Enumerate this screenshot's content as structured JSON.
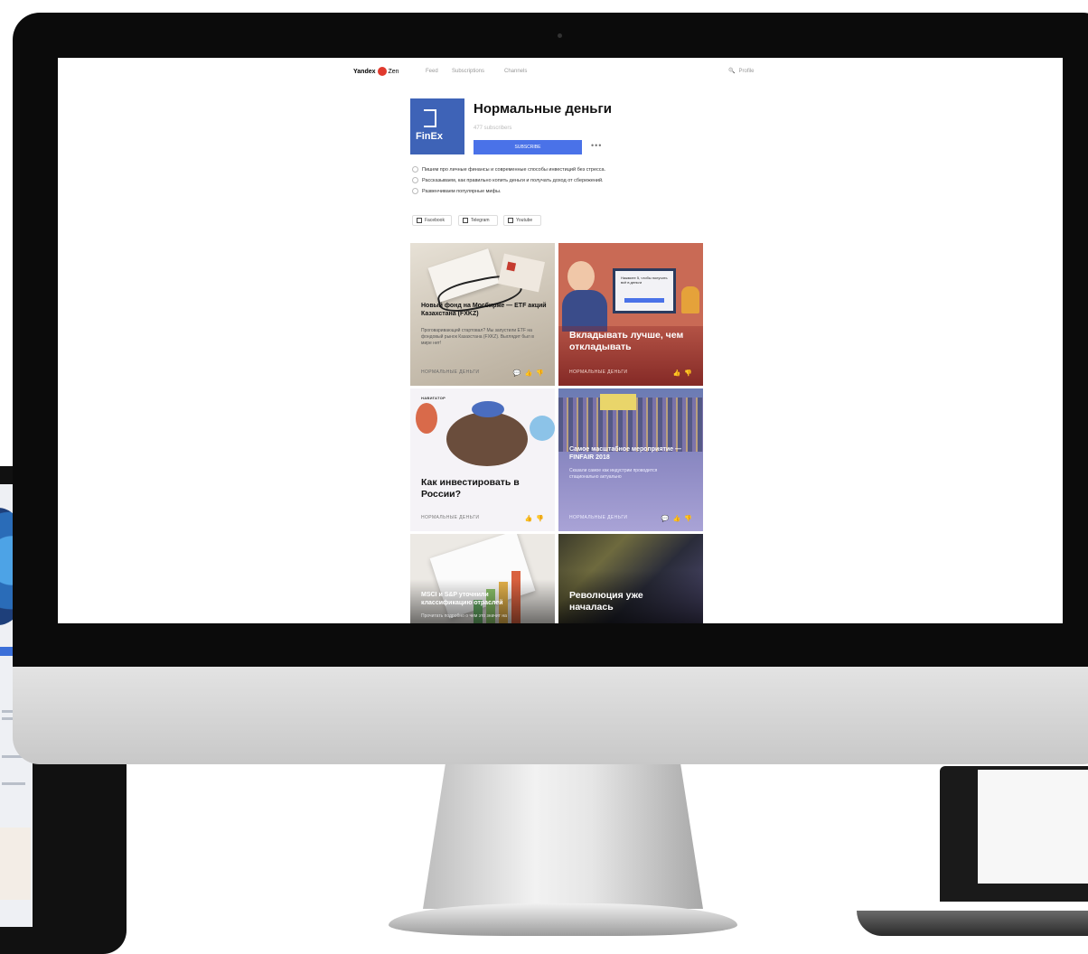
{
  "topbar": {
    "logo_text": "Yandex",
    "logo_suffix": "Zen",
    "nav": [
      "Feed",
      "Subscriptions",
      "Channels"
    ],
    "profile_label": "Profile"
  },
  "channel": {
    "avatar_text": "FinEx",
    "title": "Нормальные деньги",
    "subscribers": "477 subscribers",
    "subscribe_label": "SUBSCRIBE",
    "more_label": "•••",
    "description": [
      "Пишем про личные финансы и современные способы инвестиций без стресса.",
      "Рассказываем, как правильно копить деньги и получать доход от сбережений.",
      "Развенчиваем популярные мифы."
    ],
    "social": [
      "Facebook",
      "Telegram",
      "Youtube"
    ]
  },
  "cards": [
    {
      "title": "Новый фонд на Мосбирже — ETF акций Казахстана (FXKZ)",
      "excerpt": "Проговаривающий стартовал? Мы запустили ETF на фондовый рынок Казахстана (FXKZ). Выглядит был в мире нет!",
      "footer": "НОРМАЛЬНЫЕ ДЕНЬГИ",
      "tag": ""
    },
    {
      "title": "Вкладывать лучше, чем откладывать",
      "excerpt": "",
      "footer": "НОРМАЛЬНЫЕ ДЕНЬГИ",
      "tag": "",
      "monitor_text": "Нажмите 5, чтобы получить всё в деньги"
    },
    {
      "title": "Как инвестировать в России?",
      "excerpt": "",
      "footer": "НОРМАЛЬНЫЕ ДЕНЬГИ",
      "tag": "НАВИГАТОР"
    },
    {
      "title": "Самое масштабное мероприятие — FINFAIR 2018",
      "excerpt": "Сказали самое как индустрии проводится стационально актуально",
      "footer": "НОРМАЛЬНЫЕ ДЕНЬГИ",
      "tag": ""
    },
    {
      "title": "MSCI и S&P уточнили классификацию отраслей",
      "excerpt": "Прочитать подробно о чем это значит на",
      "footer": "",
      "tag": ""
    },
    {
      "title": "Революция уже началась",
      "excerpt": "",
      "footer": "",
      "tag": ""
    }
  ],
  "icons": {
    "comment": "💬",
    "like": "👍",
    "dislike": "👎",
    "search": "🔍"
  },
  "colors": {
    "accent": "#4a72e8",
    "logo_red": "#e03a2e",
    "avatar_bg": "#3e63b7"
  }
}
